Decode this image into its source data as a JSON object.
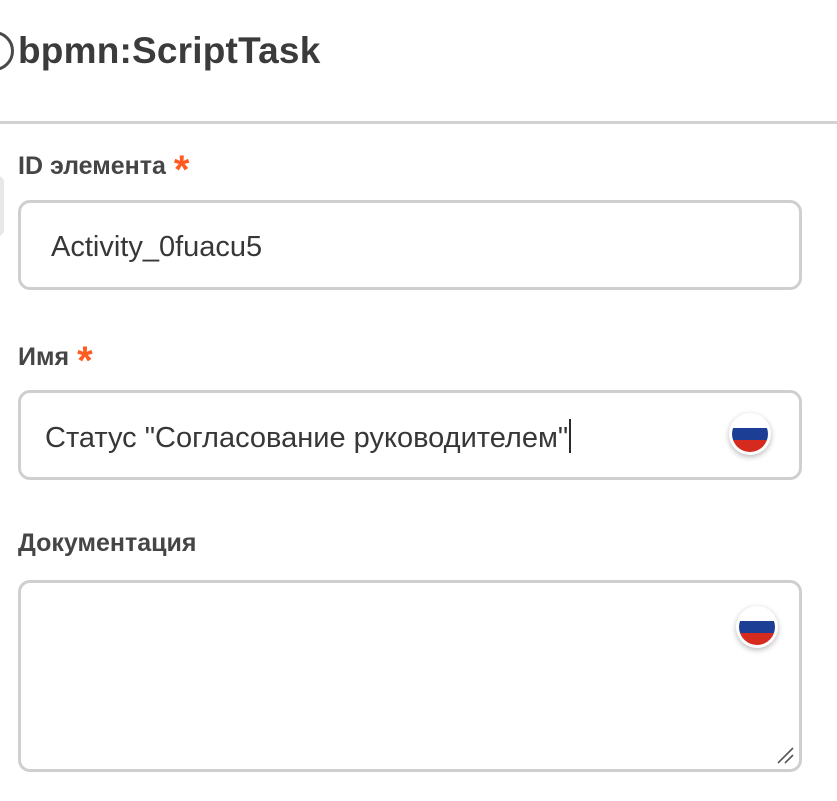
{
  "header": {
    "title": "bpmn:ScriptTask",
    "icon": "task-type-icon"
  },
  "fields": {
    "element_id": {
      "label": "ID элемента",
      "required_mark": "*",
      "value": "Activity_0fuacu5"
    },
    "name": {
      "label": "Имя",
      "required_mark": "*",
      "value": "Статус \"Согласование руководителем\"",
      "language_icon": "russia-flag-icon"
    },
    "documentation": {
      "label": "Документация",
      "value": "",
      "language_icon": "russia-flag-icon"
    }
  },
  "colors": {
    "required": "#ff5a1f",
    "input_border": "#cfcfcf",
    "divider": "#d2d2d2",
    "flag_white": "#ffffff",
    "flag_blue": "#1c3f95",
    "flag_red": "#d52b1e"
  }
}
